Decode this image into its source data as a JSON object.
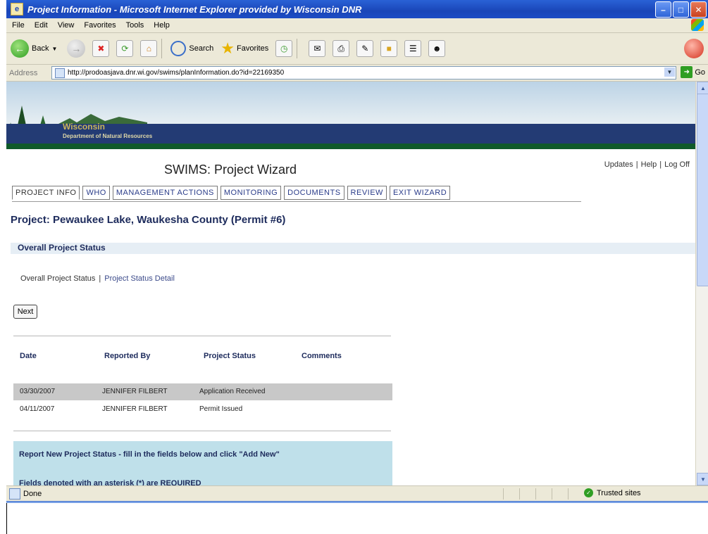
{
  "window": {
    "title": "Project Information - Microsoft Internet Explorer provided by Wisconsin DNR"
  },
  "menu": [
    "File",
    "Edit",
    "View",
    "Favorites",
    "Tools",
    "Help"
  ],
  "toolbar": {
    "back_label": "Back",
    "search_label": "Search",
    "favorites_label": "Favorites"
  },
  "address": {
    "label": "Address",
    "url": "http://prodoasjava.dnr.wi.gov/swims/planInformation.do?id=22169350",
    "go_label": "Go"
  },
  "banner": {
    "brand": "Wisconsin",
    "dept": "Department of Natural Resources"
  },
  "page": {
    "title": "SWIMS: Project Wizard",
    "links": [
      "Updates",
      "Help",
      "Log Off"
    ],
    "tabs": [
      "PROJECT INFO",
      "WHO",
      "MANAGEMENT ACTIONS",
      "MONITORING",
      "DOCUMENTS",
      "REVIEW",
      "EXIT WIZARD"
    ],
    "project_name": "Project: Pewaukee Lake, Waukesha County (Permit #6)",
    "section_title": "Overall Project Status",
    "sublinks": [
      "Overall Project Status",
      "Project Status Detail"
    ],
    "next_label": "Next"
  },
  "status_table": {
    "headers": [
      "Date",
      "Reported By",
      "Project Status",
      "Comments"
    ],
    "rows": [
      {
        "date": "03/30/2007",
        "reported_by": "JENNIFER FILBERT",
        "status": "Application Received",
        "comments": ""
      },
      {
        "date": "04/11/2007",
        "reported_by": "JENNIFER FILBERT",
        "status": "Permit Issued",
        "comments": ""
      }
    ]
  },
  "report": {
    "line1": "Report New Project Status - fill in the fields below and click \"Add New\"",
    "line2": "Fields denoted with an asterisk (*) are REQUIRED"
  },
  "statusbar": {
    "left": "Done",
    "zone": "Trusted sites"
  }
}
